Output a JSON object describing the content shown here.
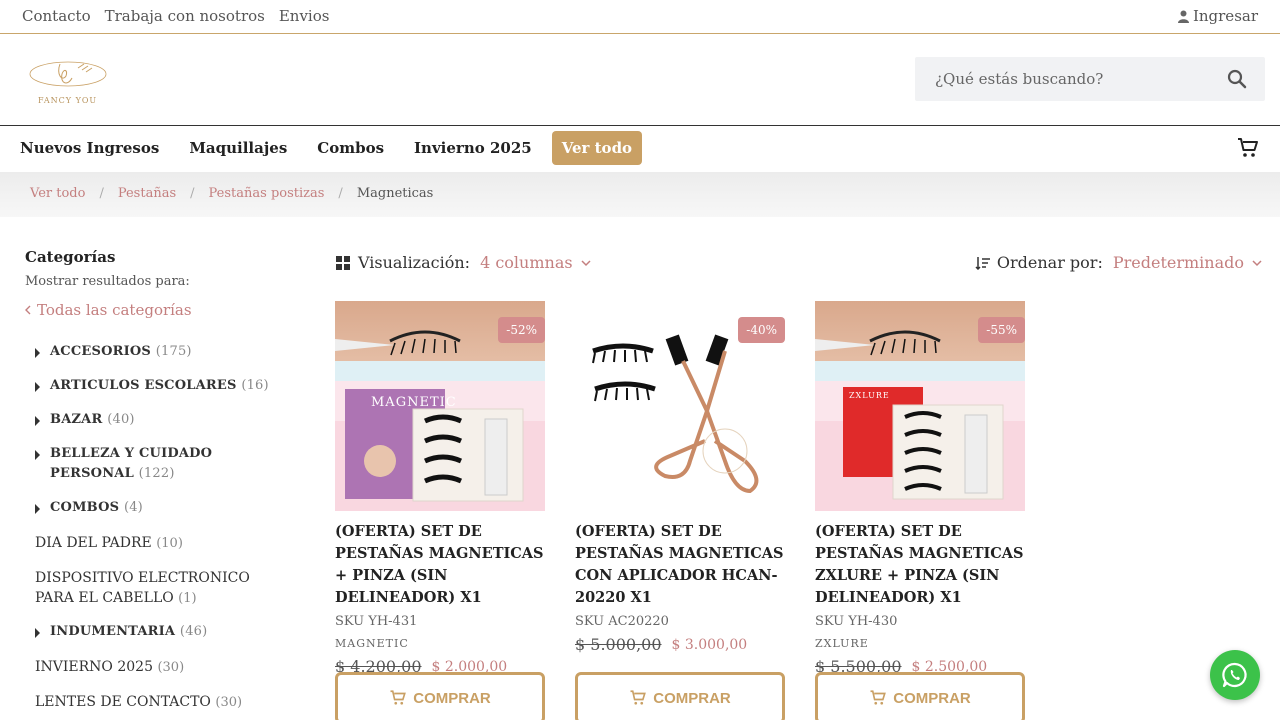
{
  "topbar": {
    "links": [
      "Contacto",
      "Trabaja con nosotros",
      "Envios"
    ],
    "login": "Ingresar"
  },
  "header": {
    "logo_text": "FANCY YOU",
    "search_placeholder": "¿Qué estás buscando?"
  },
  "nav": {
    "items": [
      "Nuevos Ingresos",
      "Maquillajes",
      "Combos",
      "Invierno 2025"
    ],
    "highlight": "Ver todo"
  },
  "breadcrumb": {
    "items": [
      "Ver todo",
      "Pestañas",
      "Pestañas postizas"
    ],
    "current": "Magneticas"
  },
  "sidebar": {
    "title": "Categorías",
    "subtitle": "Mostrar resultados para:",
    "all": "Todas las categorías",
    "categories": [
      {
        "name": "ACCESORIOS",
        "count": "(175)"
      },
      {
        "name": "ARTICULOS ESCOLARES",
        "count": "(16)"
      },
      {
        "name": "BAZAR",
        "count": "(40)"
      },
      {
        "name": "BELLEZA Y CUIDADO PERSONAL",
        "count": "(122)"
      },
      {
        "name": "COMBOS",
        "count": "(4)"
      },
      {
        "name": "DIA DEL PADRE",
        "count": "(10)"
      },
      {
        "name": "DISPOSITIVO ELECTRONICO PARA EL CABELLO",
        "count": "(1)"
      },
      {
        "name": "INDUMENTARIA",
        "count": "(46)"
      },
      {
        "name": "INVIERNO 2025",
        "count": "(30)"
      },
      {
        "name": "LENTES DE CONTACTO",
        "count": "(30)"
      }
    ]
  },
  "toolbar": {
    "view_label": "Visualización:",
    "view_value": "4 columnas",
    "sort_label": "Ordenar por:",
    "sort_value": "Predeterminado"
  },
  "products": [
    {
      "title": "(OFERTA) SET DE PESTAÑAS MAGNETICAS + PINZA (SIN DELINEADOR) X1",
      "sku": "SKU YH-431",
      "brand": "MAGNETIC",
      "old_price": "$ 4.200,00",
      "price": "$ 2.000,00",
      "discount": "-52%",
      "box_text": "MAGNETIC",
      "button": "COMPRAR"
    },
    {
      "title": "(OFERTA) SET DE PESTAÑAS MAGNETICAS CON APLICADOR HCAN-20220 X1",
      "sku": "SKU AC20220",
      "brand": "",
      "old_price": "$ 5.000,00",
      "price": "$ 3.000,00",
      "discount": "-40%",
      "button": "COMPRAR"
    },
    {
      "title": "(OFERTA) SET DE PESTAÑAS MAGNETICAS ZXLURE + PINZA (SIN DELINEADOR) X1",
      "sku": "SKU YH-430",
      "brand": "ZXLURE",
      "old_price": "$ 5.500,00",
      "price": "$ 2.500,00",
      "discount": "-55%",
      "box_text": "ZXLURE",
      "button": "COMPRAR"
    }
  ],
  "colors": {
    "accent_gold": "#c9a064",
    "rose": "#c47f7f",
    "badge": "#d48c8c",
    "whatsapp": "#3cc24a"
  }
}
